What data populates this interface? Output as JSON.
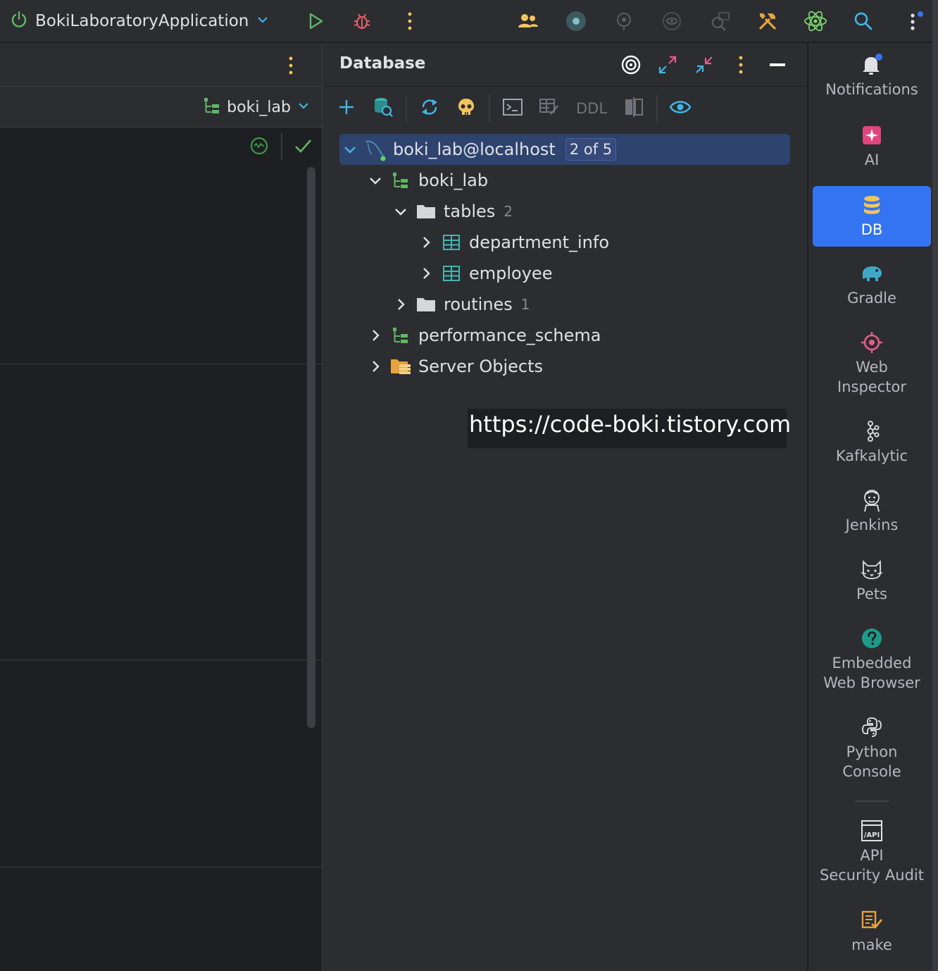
{
  "topbar": {
    "run_config": "BokiLaboratoryApplication",
    "icons": [
      "power-icon",
      "chevron-down-icon",
      "run-icon",
      "debug-icon",
      "more-vertical-icon",
      "code-with-me-icon",
      "record-icon",
      "profiler-icon",
      "coverage-icon",
      "search-usages-icon",
      "build-tools-icon",
      "react-icon",
      "search-icon",
      "settings-more-icon"
    ]
  },
  "left_panel": {
    "schema_selector": "boki_lab"
  },
  "database_panel": {
    "title": "Database",
    "toolbar": {
      "ddl_label": "DDL"
    },
    "tree": {
      "connection": {
        "label": "boki_lab@localhost",
        "badge": "2 of 5"
      },
      "schema": {
        "label": "boki_lab"
      },
      "tables_folder": {
        "label": "tables",
        "count": "2"
      },
      "tables": [
        {
          "label": "department_info"
        },
        {
          "label": "employee"
        }
      ],
      "routines_folder": {
        "label": "routines",
        "count": "1"
      },
      "performance_schema": {
        "label": "performance_schema"
      },
      "server_objects": {
        "label": "Server Objects"
      }
    }
  },
  "watermark": "https://code-boki.tistory.com",
  "right_strip": {
    "items": [
      {
        "label": "Notifications",
        "icon": "bell-icon"
      },
      {
        "label": "AI",
        "icon": "ai-assistant-icon"
      },
      {
        "label": "DB",
        "icon": "database-icon",
        "active": true
      },
      {
        "label": "Gradle",
        "icon": "gradle-elephant-icon"
      },
      {
        "label": "Web\nInspector",
        "icon": "target-icon"
      },
      {
        "label": "Kafkalytic",
        "icon": "kafka-icon"
      },
      {
        "label": "Jenkins",
        "icon": "jenkins-icon"
      },
      {
        "label": "Pets",
        "icon": "cat-icon"
      },
      {
        "label": "Embedded\nWeb Browser",
        "icon": "help-icon"
      },
      {
        "label": "Python\nConsole",
        "icon": "python-icon"
      },
      {
        "label": "API\nSecurity Audit",
        "icon": "api-icon"
      },
      {
        "label": "make",
        "icon": "make-icon"
      }
    ]
  },
  "colors": {
    "accent": "#3574f0",
    "selection": "#2e436e",
    "panel_bg": "#2b2d30",
    "editor_bg": "#1e1f22",
    "green": "#5fb865",
    "teal": "#3fb6b2",
    "yellow": "#f2c55c",
    "orange": "#e6a23c",
    "pink": "#e55c8a"
  }
}
